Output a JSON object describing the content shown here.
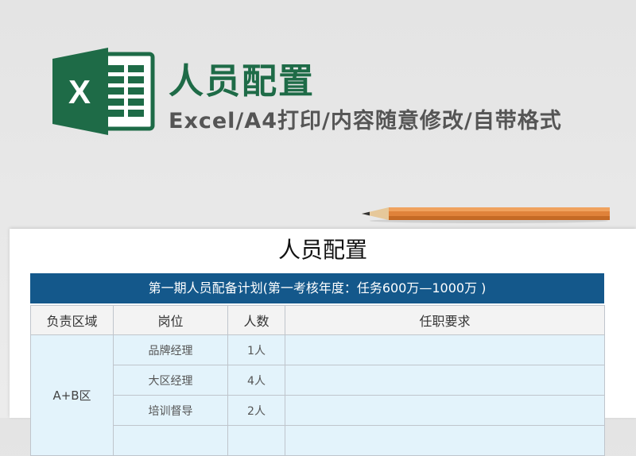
{
  "header": {
    "title": "人员配置",
    "subtitle": "Excel/A4打印/内容随意修改/自带格式"
  },
  "colors": {
    "excel_green": "#1e6b47",
    "band_blue": "#14588b",
    "cell_blue": "#e3f3fb"
  },
  "sheet": {
    "title": "人员配置",
    "band": "第一期人员配备计划(第一考核年度：任务600万—1000万 )",
    "columns": [
      "负责区域",
      "岗位",
      "人数",
      "任职要求"
    ],
    "region": "A+B区",
    "rows": [
      {
        "position": "品牌经理",
        "count": "1人",
        "requirement": ""
      },
      {
        "position": "大区经理",
        "count": "4人",
        "requirement": ""
      },
      {
        "position": "培训督导",
        "count": "2人",
        "requirement": ""
      }
    ]
  }
}
